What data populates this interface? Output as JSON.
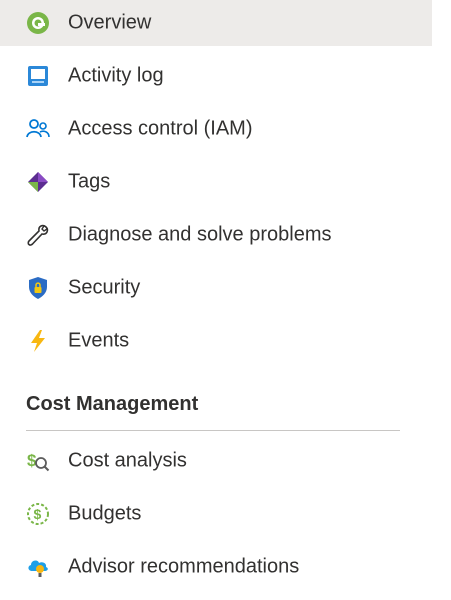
{
  "nav": {
    "items": [
      {
        "label": "Overview",
        "icon": "overview-icon",
        "selected": true
      },
      {
        "label": "Activity log",
        "icon": "activity-log-icon"
      },
      {
        "label": "Access control (IAM)",
        "icon": "people-icon"
      },
      {
        "label": "Tags",
        "icon": "tag-icon"
      },
      {
        "label": "Diagnose and solve problems",
        "icon": "wrench-icon"
      },
      {
        "label": "Security",
        "icon": "shield-icon"
      },
      {
        "label": "Events",
        "icon": "lightning-icon"
      }
    ],
    "cost_section": {
      "title": "Cost Management",
      "items": [
        {
          "label": "Cost analysis",
          "icon": "cost-analysis-icon"
        },
        {
          "label": "Budgets",
          "icon": "budget-icon"
        },
        {
          "label": "Advisor recommendations",
          "icon": "advisor-icon"
        }
      ]
    }
  },
  "colors": {
    "selected_bg": "#edebe9",
    "text": "#323130",
    "divider": "#c8c6c4"
  }
}
